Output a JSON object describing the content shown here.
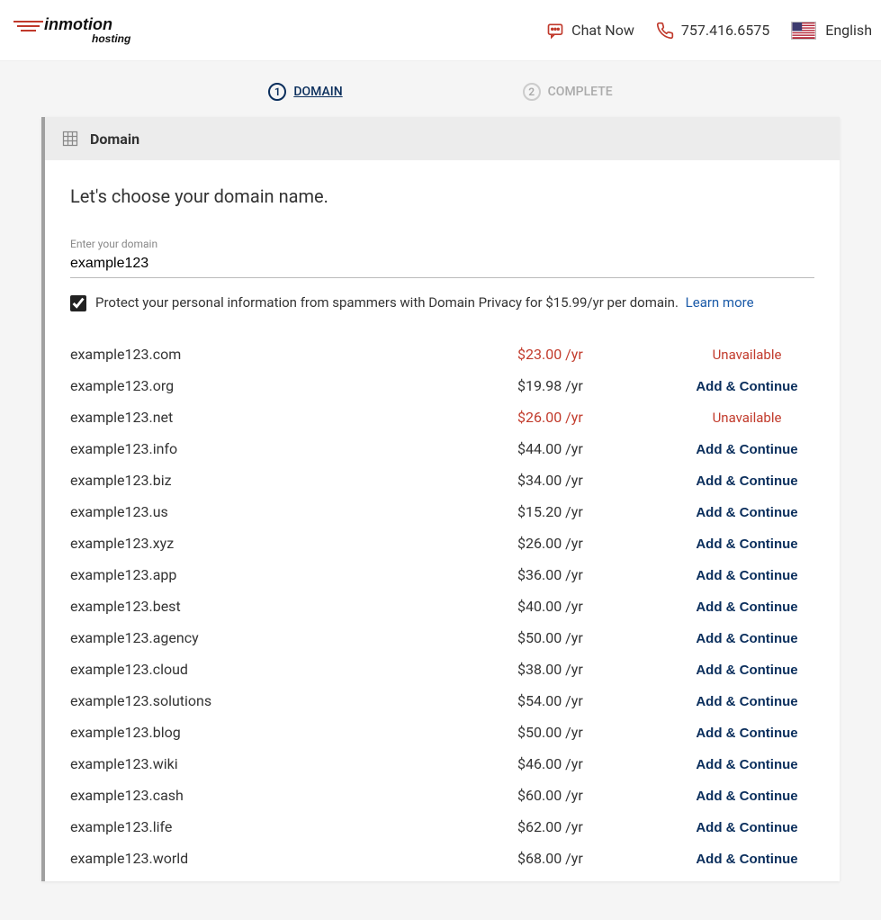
{
  "header": {
    "brand": "inmotion hosting",
    "chat_label": "Chat Now",
    "phone_label": "757.416.6575",
    "language_label": "English"
  },
  "stepper": {
    "steps": [
      {
        "num": "1",
        "label": "DOMAIN",
        "active": true
      },
      {
        "num": "2",
        "label": "COMPLETE",
        "active": false
      }
    ]
  },
  "panel": {
    "title": "Domain",
    "prompt": "Let's choose your domain name.",
    "input_label": "Enter your domain",
    "input_value": "example123",
    "privacy_checked": true,
    "privacy_text": "Protect your personal information from spammers with Domain Privacy for $15.99/yr per domain.",
    "learn_more_label": "Learn more"
  },
  "action_labels": {
    "add": "Add & Continue",
    "unavailable": "Unavailable"
  },
  "results": [
    {
      "name": "example123.com",
      "price": "$23.00 /yr",
      "available": false
    },
    {
      "name": "example123.org",
      "price": "$19.98 /yr",
      "available": true
    },
    {
      "name": "example123.net",
      "price": "$26.00 /yr",
      "available": false
    },
    {
      "name": "example123.info",
      "price": "$44.00 /yr",
      "available": true
    },
    {
      "name": "example123.biz",
      "price": "$34.00 /yr",
      "available": true
    },
    {
      "name": "example123.us",
      "price": "$15.20 /yr",
      "available": true
    },
    {
      "name": "example123.xyz",
      "price": "$26.00 /yr",
      "available": true
    },
    {
      "name": "example123.app",
      "price": "$36.00 /yr",
      "available": true
    },
    {
      "name": "example123.best",
      "price": "$40.00 /yr",
      "available": true
    },
    {
      "name": "example123.agency",
      "price": "$50.00 /yr",
      "available": true
    },
    {
      "name": "example123.cloud",
      "price": "$38.00 /yr",
      "available": true
    },
    {
      "name": "example123.solutions",
      "price": "$54.00 /yr",
      "available": true
    },
    {
      "name": "example123.blog",
      "price": "$50.00 /yr",
      "available": true
    },
    {
      "name": "example123.wiki",
      "price": "$46.00 /yr",
      "available": true
    },
    {
      "name": "example123.cash",
      "price": "$60.00 /yr",
      "available": true
    },
    {
      "name": "example123.life",
      "price": "$62.00 /yr",
      "available": true
    },
    {
      "name": "example123.world",
      "price": "$68.00 /yr",
      "available": true
    }
  ]
}
